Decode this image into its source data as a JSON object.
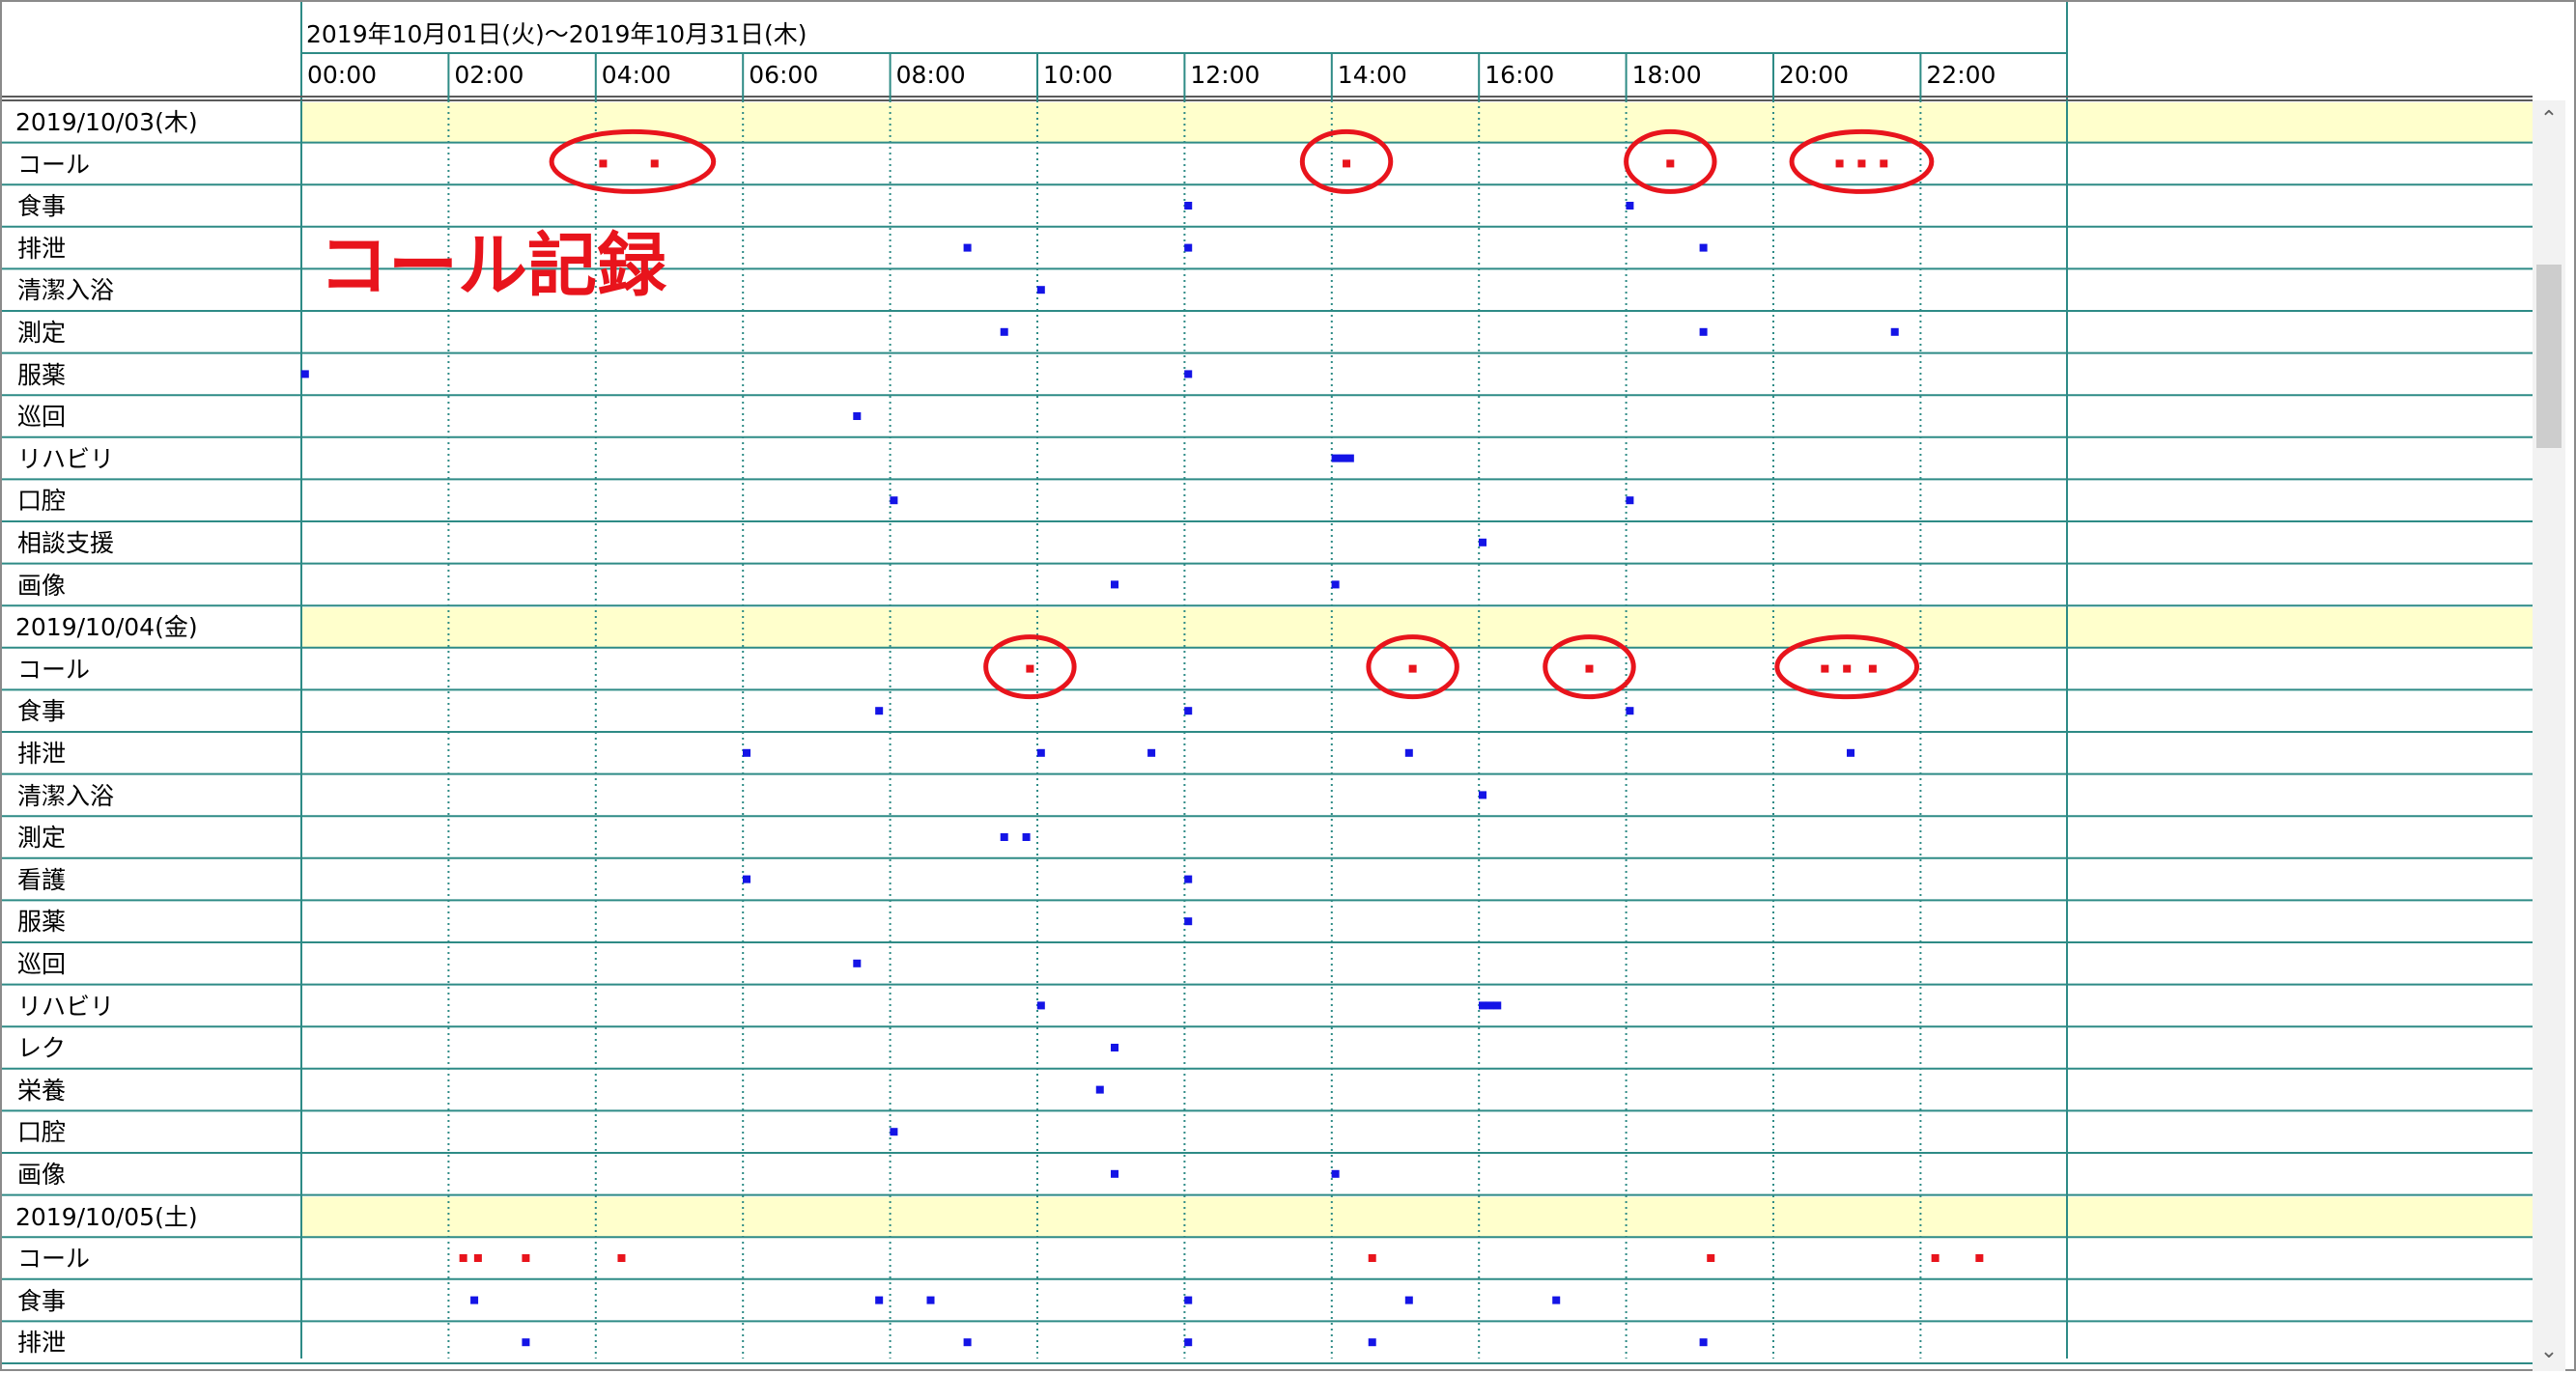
{
  "header": {
    "range": "2019年10月01日(火)～2019年10月31日(木)",
    "hours": [
      "00:00",
      "02:00",
      "04:00",
      "06:00",
      "08:00",
      "10:00",
      "12:00",
      "14:00",
      "16:00",
      "18:00",
      "20:00",
      "22:00"
    ]
  },
  "annotation": "コール記録",
  "colors": {
    "grid": "#2e8b86",
    "day_band": "#ffffcc",
    "blue_marker": "#1414e6",
    "red_marker": "#e8141c"
  },
  "days": [
    {
      "label": "2019/10/03(木)",
      "rows": [
        {
          "label": "コール",
          "color": "red",
          "events": [
            4.1,
            4.8,
            14.2,
            18.6,
            20.9,
            21.2,
            21.5
          ],
          "circles": [
            [
              4.5,
              2.2
            ],
            [
              14.2,
              1.2
            ],
            [
              18.6,
              1.2
            ],
            [
              21.2,
              1.9
            ]
          ]
        },
        {
          "label": "食事",
          "color": "blue",
          "events": [
            12.05,
            18.05
          ]
        },
        {
          "label": "排泄",
          "color": "blue",
          "events": [
            9.05,
            12.05,
            19.05
          ]
        },
        {
          "label": "清潔入浴",
          "color": "blue",
          "events": [
            10.05
          ]
        },
        {
          "label": "測定",
          "color": "blue",
          "events": [
            9.55,
            19.05,
            21.65
          ]
        },
        {
          "label": "服薬",
          "color": "blue",
          "events": [
            0.05,
            12.05
          ]
        },
        {
          "label": "巡回",
          "color": "blue",
          "events": [
            7.55
          ]
        },
        {
          "label": "リハビリ",
          "color": "blue",
          "events": [
            14.05,
            14.15,
            14.25
          ]
        },
        {
          "label": "口腔",
          "color": "blue",
          "events": [
            8.05,
            18.05
          ]
        },
        {
          "label": "相談支援",
          "color": "blue",
          "events": [
            16.05
          ]
        },
        {
          "label": "画像",
          "color": "blue",
          "events": [
            11.05,
            14.05
          ]
        }
      ]
    },
    {
      "label": "2019/10/04(金)",
      "rows": [
        {
          "label": "コール",
          "color": "red",
          "events": [
            9.9,
            15.1,
            17.5,
            20.7,
            21.0,
            21.35
          ],
          "circles": [
            [
              9.9,
              1.2
            ],
            [
              15.1,
              1.2
            ],
            [
              17.5,
              1.2
            ],
            [
              21.0,
              1.9
            ]
          ]
        },
        {
          "label": "食事",
          "color": "blue",
          "events": [
            7.85,
            12.05,
            18.05
          ]
        },
        {
          "label": "排泄",
          "color": "blue",
          "events": [
            6.05,
            10.05,
            11.55,
            15.05,
            21.05
          ]
        },
        {
          "label": "清潔入浴",
          "color": "blue",
          "events": [
            16.05
          ]
        },
        {
          "label": "測定",
          "color": "blue",
          "events": [
            9.55,
            9.85
          ]
        },
        {
          "label": "看護",
          "color": "blue",
          "events": [
            6.05,
            12.05
          ]
        },
        {
          "label": "服薬",
          "color": "blue",
          "events": [
            12.05
          ]
        },
        {
          "label": "巡回",
          "color": "blue",
          "events": [
            7.55
          ]
        },
        {
          "label": "リハビリ",
          "color": "blue",
          "events": [
            10.05,
            16.05,
            16.15,
            16.25
          ]
        },
        {
          "label": "レク",
          "color": "blue",
          "events": [
            11.05
          ]
        },
        {
          "label": "栄養",
          "color": "blue",
          "events": [
            10.85
          ]
        },
        {
          "label": "口腔",
          "color": "blue",
          "events": [
            8.05
          ]
        },
        {
          "label": "画像",
          "color": "blue",
          "events": [
            11.05,
            14.05
          ]
        }
      ]
    },
    {
      "label": "2019/10/05(土)",
      "rows": [
        {
          "label": "コール",
          "color": "red",
          "events": [
            2.2,
            2.4,
            3.05,
            4.35,
            14.55,
            19.15,
            22.2,
            22.8
          ]
        },
        {
          "label": "食事",
          "color": "blue",
          "events": [
            2.35,
            7.85,
            8.55,
            12.05,
            15.05,
            17.05
          ]
        },
        {
          "label": "排泄",
          "color": "blue",
          "events": [
            3.05,
            9.05,
            12.05,
            14.55,
            19.05
          ]
        }
      ]
    }
  ]
}
